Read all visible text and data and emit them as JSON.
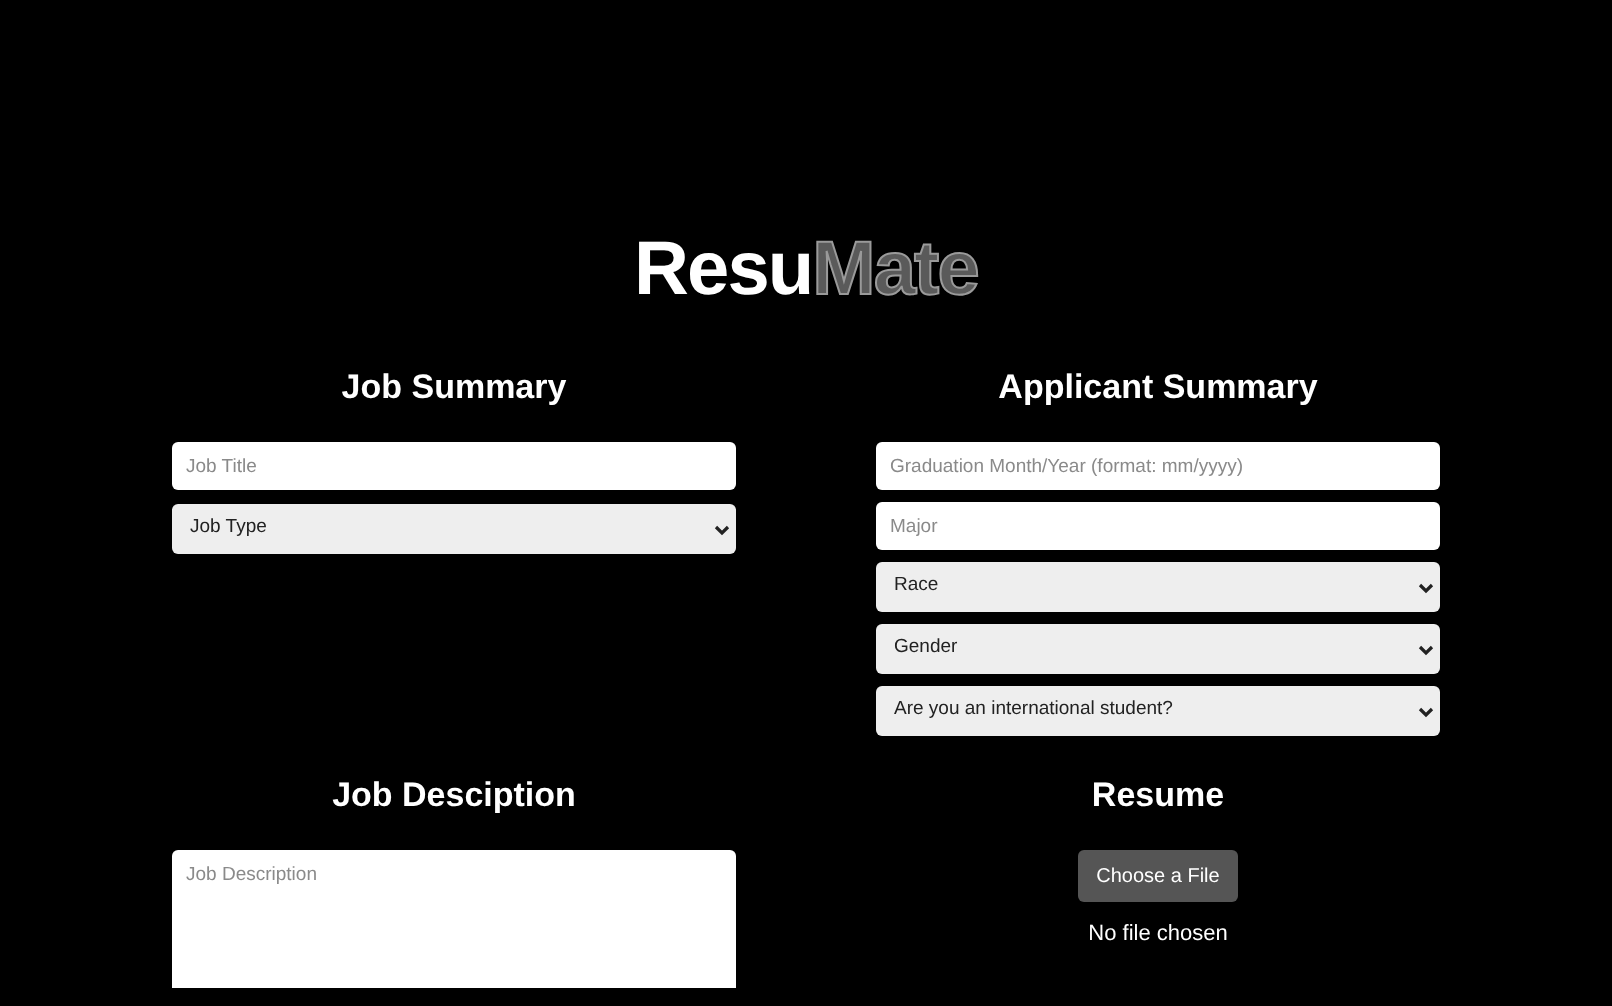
{
  "logo": {
    "parts": [
      {
        "text": "Resu",
        "kind": "light"
      },
      {
        "text": "Mate",
        "kind": "dim"
      }
    ]
  },
  "job_summary": {
    "heading": "Job Summary",
    "fields": [
      {
        "kind": "input",
        "placeholder": "Job Title"
      },
      {
        "kind": "select",
        "value": "Job Type"
      }
    ]
  },
  "applicant_summary": {
    "heading": "Applicant Summary",
    "fields": [
      {
        "kind": "input",
        "placeholder": "Graduation Month/Year (format: mm/yyyy)"
      },
      {
        "kind": "input",
        "placeholder": "Major"
      },
      {
        "kind": "select",
        "value": "Race"
      },
      {
        "kind": "select",
        "value": "Gender"
      },
      {
        "kind": "select",
        "value": "Are you an international student?"
      }
    ]
  },
  "job_description": {
    "heading": "Job Desciption",
    "placeholder": "Job Description"
  },
  "resume": {
    "heading": "Resume",
    "button": "Choose a File",
    "status": "No file chosen"
  }
}
